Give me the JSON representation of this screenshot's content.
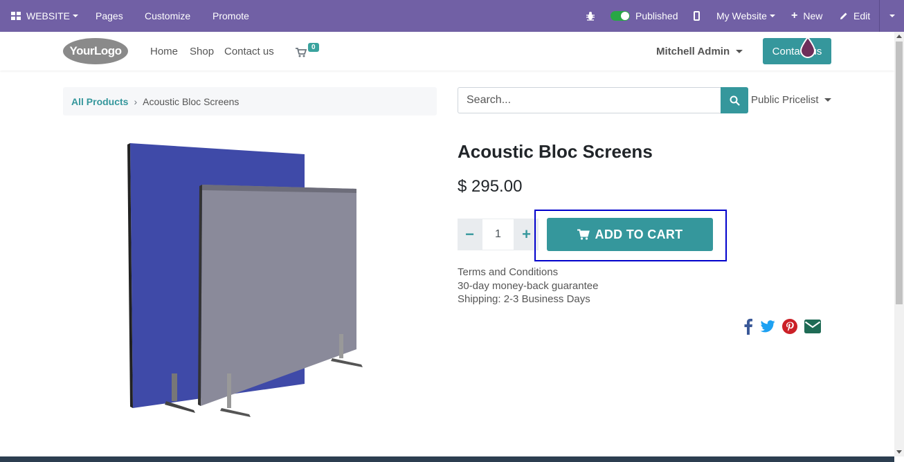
{
  "adminbar": {
    "website_label": "WEBSITE",
    "pages_label": "Pages",
    "customize_label": "Customize",
    "promote_label": "Promote",
    "published_label": "Published",
    "my_website_label": "My Website",
    "new_label": "New",
    "edit_label": "Edit"
  },
  "header": {
    "logo_text": "YourLogo",
    "nav": [
      "Home",
      "Shop",
      "Contact us"
    ],
    "cart_count": "0",
    "user_name": "Mitchell Admin",
    "contact_button": "Contact us"
  },
  "breadcrumb": {
    "parent": "All Products",
    "current": "Acoustic Bloc Screens"
  },
  "search": {
    "placeholder": "Search...",
    "pricelist": "Public Pricelist"
  },
  "product": {
    "name": "Acoustic Bloc Screens",
    "price": "$ 295.00",
    "quantity": "1",
    "add_to_cart": "ADD TO CART",
    "terms": [
      "Terms and Conditions",
      "30-day money-back guarantee",
      "Shipping: 2-3 Business Days"
    ]
  },
  "colors": {
    "admin_bar": "#7160a5",
    "accent": "#35979c",
    "highlight": "#0000cc"
  }
}
